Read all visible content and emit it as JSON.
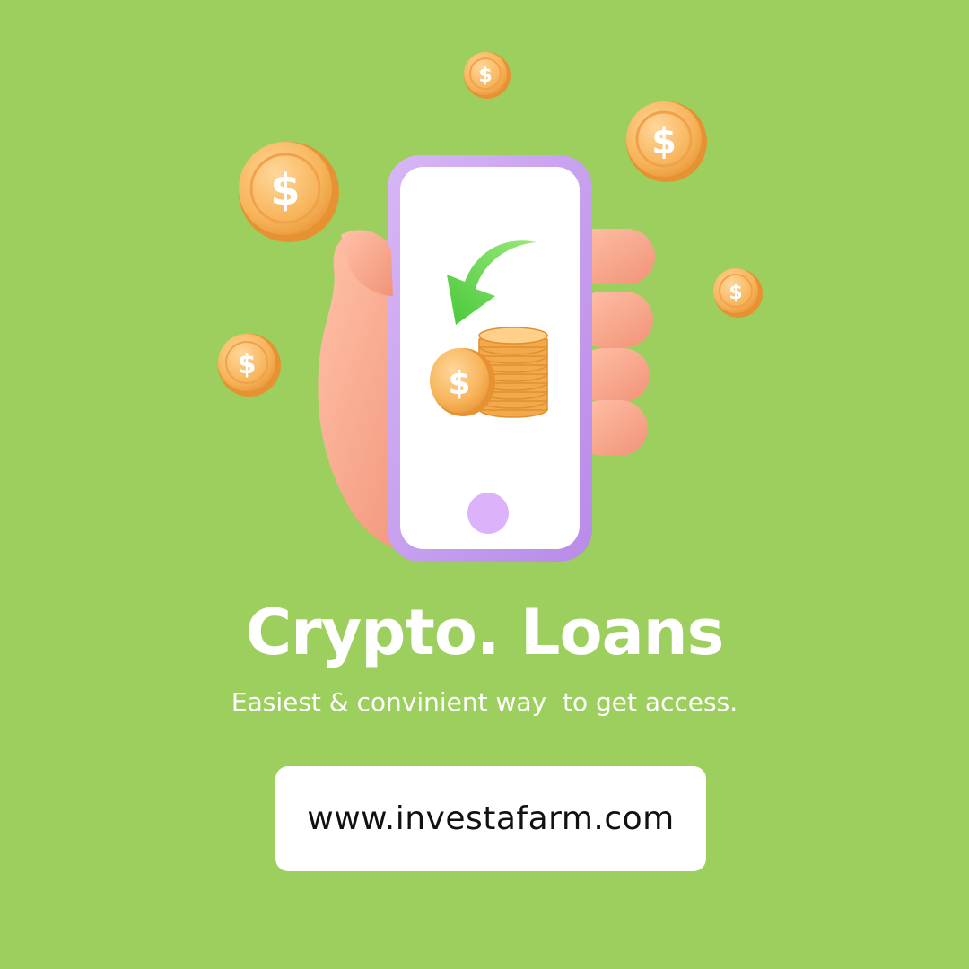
{
  "headline": "Crypto. Loans",
  "tagline": "Easiest & convinient way  to get access.",
  "website": "www.investafarm.com",
  "coin_glyph": "$",
  "colors": {
    "background": "#9ccf5d",
    "coin": "#f6b457",
    "phone_frame": "#c9a3f0",
    "arrow": "#65d94c",
    "hand": "#f5a58c"
  },
  "icons": [
    "dollar-coin-icon",
    "phone-icon",
    "hand-icon",
    "arrow-icon",
    "coin-stack-icon"
  ]
}
